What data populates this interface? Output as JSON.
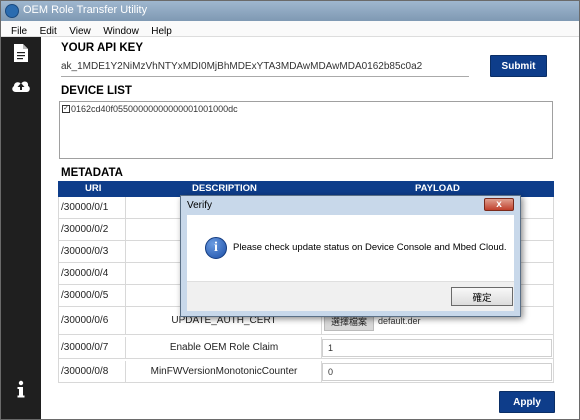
{
  "window": {
    "title": "OEM Role Transfer Utility",
    "menu": [
      "File",
      "Edit",
      "View",
      "Window",
      "Help"
    ]
  },
  "sidebar": {
    "icons": [
      "document-icon",
      "upload-icon",
      "info-icon"
    ]
  },
  "api": {
    "heading": "YOUR API KEY",
    "key_value": "ak_1MDE1Y2NiMzVhNTYxMDI0MjBhMDExYTA3MDAwMDAwMDA0162b85c0a2",
    "submit_label": "Submit"
  },
  "devices": {
    "heading": "DEVICE LIST",
    "items": [
      {
        "id": "0162cd40f05500000000000001001000dc",
        "checked": true
      }
    ]
  },
  "metadata": {
    "heading": "METADATA",
    "columns": [
      "URI",
      "DESCRIPTION",
      "PAYLOAD"
    ],
    "rows": [
      {
        "uri": "/30000/0/1",
        "description": "",
        "payload": ""
      },
      {
        "uri": "/30000/0/2",
        "description": "",
        "payload": ""
      },
      {
        "uri": "/30000/0/3",
        "description": "",
        "payload": ""
      },
      {
        "uri": "/30000/0/4",
        "description": "",
        "payload": ""
      },
      {
        "uri": "/30000/0/5",
        "description": "",
        "payload": ""
      },
      {
        "uri": "/30000/0/6",
        "description": "UPDATE_AUTH_CERT",
        "file_button": "選擇檔案",
        "file_name": "default.der"
      },
      {
        "uri": "/30000/0/7",
        "description": "Enable OEM Role Claim",
        "payload": "1"
      },
      {
        "uri": "/30000/0/8",
        "description": "MinFWVersionMonotonicCounter",
        "payload": "0"
      }
    ],
    "apply_label": "Apply"
  },
  "dialog": {
    "title": "Verify",
    "close_glyph": "x",
    "icon_glyph": "i",
    "message": "Please check update status on Device Console and Mbed Cloud.",
    "ok_label": "確定"
  },
  "colors": {
    "accent": "#0e3d8a",
    "sidebar": "#1f1f1f"
  }
}
